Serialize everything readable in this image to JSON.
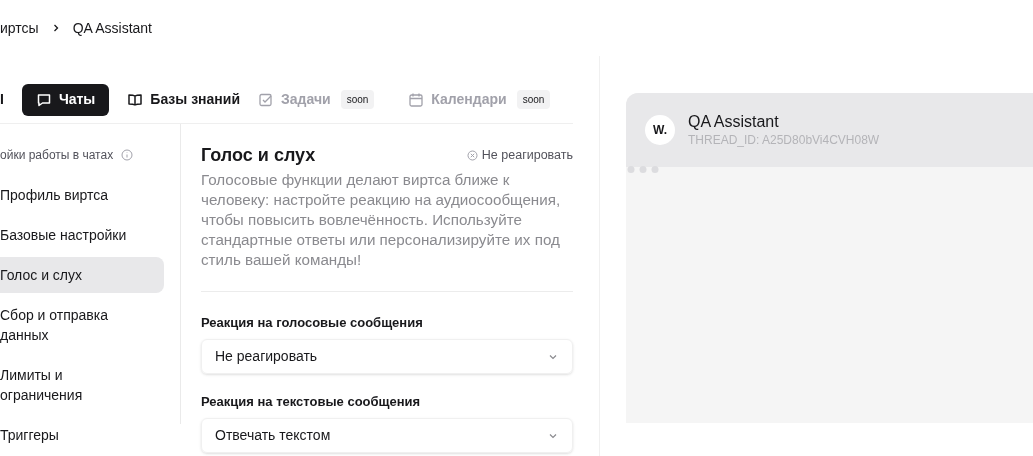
{
  "breadcrumb": [
    {
      "label": "иртсы"
    },
    {
      "label": "QA Assistant"
    }
  ],
  "tabs": [
    {
      "label": "I",
      "kind": "plain",
      "selected": false,
      "disabled": false
    },
    {
      "label": "Чаты",
      "kind": "chat",
      "selected": true,
      "disabled": false
    },
    {
      "label": "Базы знаний",
      "kind": "book",
      "selected": false,
      "disabled": false
    },
    {
      "label": "Задачи",
      "kind": "task",
      "selected": false,
      "disabled": true,
      "badge": "soon"
    },
    {
      "label": "Календари",
      "kind": "calendar",
      "selected": false,
      "disabled": true,
      "badge": "soon"
    }
  ],
  "sidebar": {
    "title": "ойки работы в чатах",
    "items": [
      {
        "label": "Профиль виртса",
        "selected": false
      },
      {
        "label": "Базовые настройки",
        "selected": false
      },
      {
        "label": "Голос и слух",
        "selected": true
      },
      {
        "label": "Сбор и отправка данных",
        "selected": false
      },
      {
        "label": "Лимиты и ограничения",
        "selected": false
      },
      {
        "label": "Триггеры",
        "selected": false
      }
    ]
  },
  "section": {
    "title": "Голос и слух",
    "status": "Не реагировать",
    "description": "Голосовые функции делают виртса ближе к человеку: настройте реакцию на аудиосообщения, чтобы повысить вовлечённость. Используйте стандартные ответы или персонализируйте их под стиль вашей команды!",
    "fields": [
      {
        "label": "Реакция на голосовые сообщения",
        "value": "Не реагировать"
      },
      {
        "label": "Реакция на текстовые сообщения",
        "value": "Отвечать текстом"
      }
    ]
  },
  "chat_preview": {
    "avatar": "W.",
    "title": "QA Assistant",
    "thread_id": "THREAD_ID: A25D80bVi4CVH08W"
  }
}
